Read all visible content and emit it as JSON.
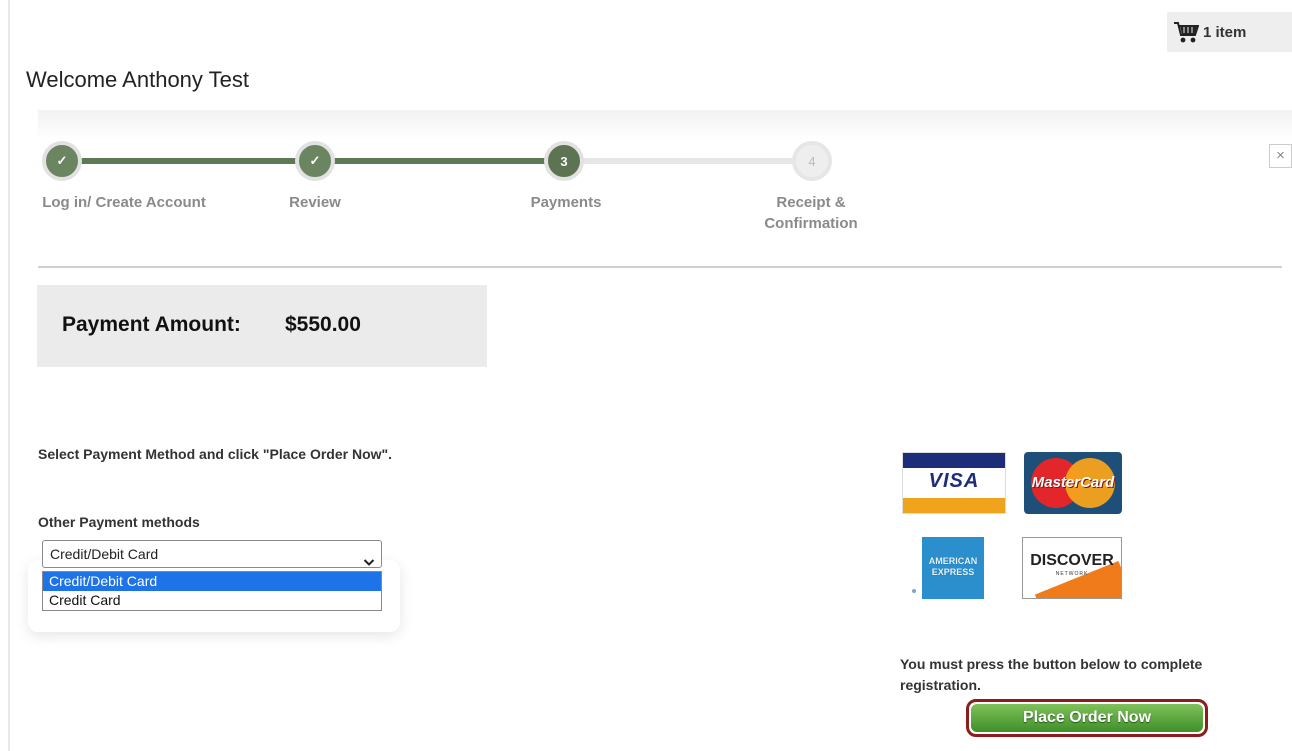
{
  "header": {
    "cart_label": "1 item",
    "welcome": "Welcome Anthony Test",
    "close_symbol": "×"
  },
  "steps": [
    {
      "label": "Log in/ Create Account",
      "marker": "✓",
      "state": "done"
    },
    {
      "label": "Review",
      "marker": "✓",
      "state": "done"
    },
    {
      "label": "Payments",
      "marker": "3",
      "state": "active"
    },
    {
      "label": "Receipt & Confirmation",
      "label_line1": "Receipt &",
      "label_line2": "Confirmation",
      "marker": "4",
      "state": "todo"
    }
  ],
  "payment": {
    "amount_label": "Payment Amount:",
    "amount_value": "$550.00"
  },
  "method": {
    "instruction": "Select Payment Method and click \"Place Order Now\".",
    "other_label": "Other Payment methods",
    "selected": "Credit/Debit Card",
    "options": [
      "Credit/Debit Card",
      "Credit Card"
    ]
  },
  "cards": {
    "visa": "VISA",
    "mastercard": "MasterCard",
    "amex_line1": "AMERICAN",
    "amex_line2": "EXPRESS",
    "discover": "DISCOVER",
    "discover_sub": "NETWORK"
  },
  "footer": {
    "notice": "You must press the button below to complete registration.",
    "place_order": "Place Order Now"
  },
  "colors": {
    "step_done": "#6b8560",
    "button_green": "#3f8f29",
    "button_border": "#8b1d1d",
    "option_highlight": "#1e73e8"
  }
}
